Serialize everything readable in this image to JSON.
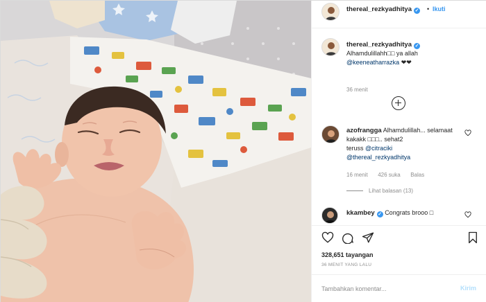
{
  "post": {
    "author": "thereal_rezkyadhitya",
    "verified_mark": "✓",
    "separator": "•",
    "follow_label": "Ikuti",
    "caption": {
      "author": "thereal_rezkyadhitya",
      "text": "Alhamdulillahh□□ ya allah",
      "mention": "@keeneatharrazka",
      "suffix": " ❤❤",
      "time": "36 menit"
    },
    "load_more_icon": "plus-circle-icon"
  },
  "comments": [
    {
      "author": "azofrangga",
      "text_a": "Alhamdulillah...",
      "text_b": "selamaat kakakk □□□.. sehat2",
      "text_c": "teruss",
      "mention_1": "@citraciki",
      "mention_2": "@thereal_rezkyadhitya",
      "time": "16 menit",
      "likes": "426 suka",
      "reply_label": "Balas",
      "view_replies": "Lihat balasan (13)"
    },
    {
      "author": "kkambey",
      "text": "Congrats brooo □"
    }
  ],
  "actions": {
    "like_icon": "heart-icon",
    "comment_icon": "comment-icon",
    "share_icon": "send-icon",
    "save_icon": "bookmark-icon"
  },
  "stats": {
    "views": "328,651 tayangan",
    "ago": "36 MENIT YANG LALU"
  },
  "add_comment": {
    "placeholder": "Tambahkan komentar...",
    "send_label": "Kirim"
  },
  "colors": {
    "accent": "#3897f0",
    "link": "#00376b",
    "muted": "#8e8e8e",
    "send_disabled": "#b2dffc"
  }
}
